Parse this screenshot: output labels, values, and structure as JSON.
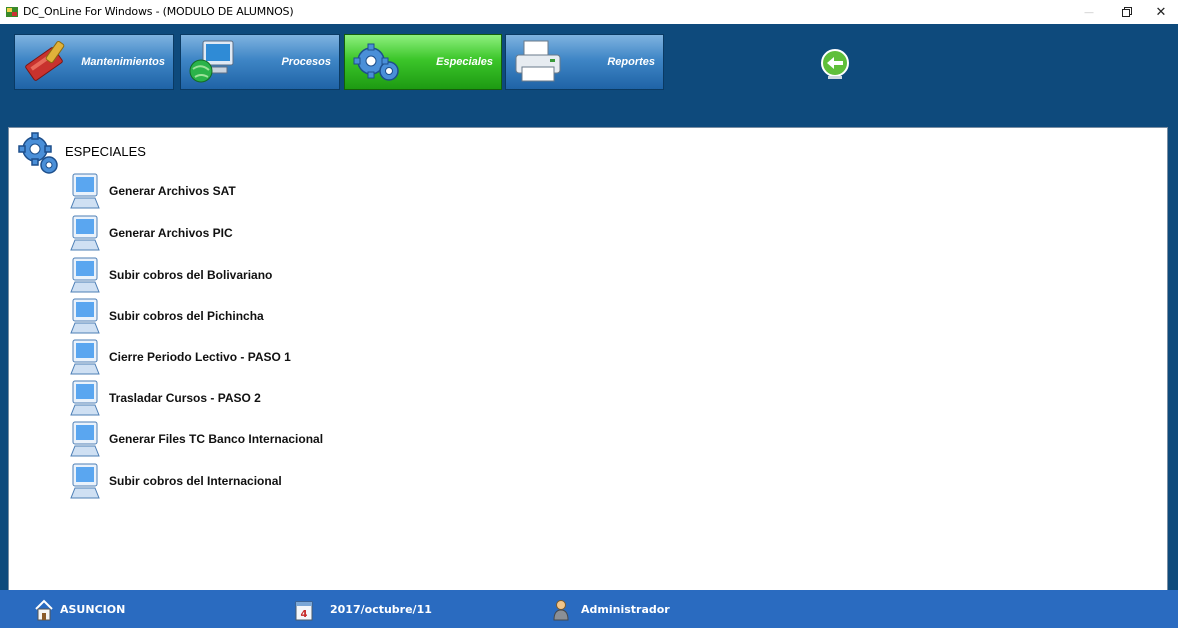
{
  "window": {
    "title": "DC_OnLine For Windows - (MODULO DE ALUMNOS)",
    "restore_symbol": "🗗",
    "close_symbol": "✕",
    "minimize_symbol": "—"
  },
  "toolbar": {
    "buttons": [
      {
        "label": "Mantenimientos",
        "icon": "tools-icon",
        "active": false
      },
      {
        "label": "Procesos",
        "icon": "computer-globe-icon",
        "active": false
      },
      {
        "label": "Especiales",
        "icon": "gears-icon",
        "active": true
      },
      {
        "label": "Reportes",
        "icon": "printer-icon",
        "active": false
      }
    ],
    "back_icon": "back-arrow-icon"
  },
  "content": {
    "section_title": "ESPECIALES",
    "section_icon": "gears-icon",
    "items": [
      {
        "label": "Generar Archivos SAT",
        "icon": "monitor-icon"
      },
      {
        "label": "Generar Archivos PIC",
        "icon": "monitor-icon"
      },
      {
        "label": "Subir cobros del Bolivariano",
        "icon": "monitor-icon"
      },
      {
        "label": "Subir cobros del Pichincha",
        "icon": "monitor-icon"
      },
      {
        "label": "Cierre Periodo Lectivo - PASO 1",
        "icon": "monitor-icon"
      },
      {
        "label": "Trasladar Cursos - PASO 2",
        "icon": "monitor-icon"
      },
      {
        "label": "Generar Files TC Banco Internacional",
        "icon": "monitor-icon"
      },
      {
        "label": "Subir cobros del Internacional",
        "icon": "monitor-icon"
      }
    ]
  },
  "statusbar": {
    "location": "ASUNCION",
    "date": "2017/octubre/11",
    "user": "Administrador"
  },
  "colors": {
    "frame": "#0e4a7c",
    "toolbar_button": "#3f86c6",
    "active_button": "#3cc62a",
    "statusbar": "#2a6bc0"
  }
}
